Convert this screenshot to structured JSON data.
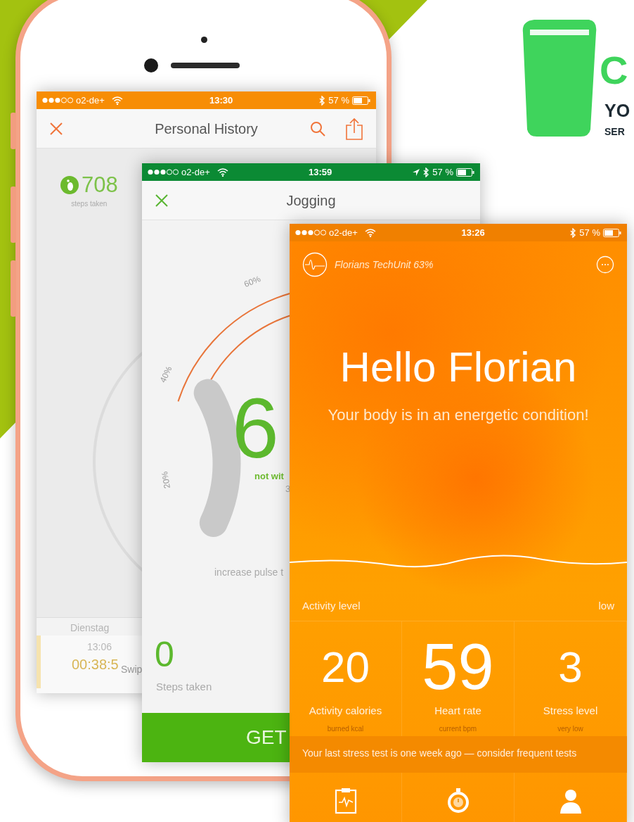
{
  "logo": {
    "letter": "C",
    "line_1": "YO",
    "line_2": "SER"
  },
  "history_screen": {
    "status": {
      "carrier": "o2-de+",
      "time": "13:30",
      "battery": "57 %",
      "location": false
    },
    "title": "Personal History",
    "steps": "708",
    "steps_label": "steps taken",
    "day": "Dienstag",
    "entry_time": "13:06",
    "entry_duration": "00:38:5",
    "hint": "Swip"
  },
  "jogging_screen": {
    "status": {
      "carrier": "o2-de+",
      "time": "13:59",
      "battery": "57 %",
      "location": true
    },
    "title": "Jogging",
    "gauge_ticks": [
      "60%",
      "40%",
      "20%"
    ],
    "pulse_digit": "6",
    "pulse_status": "not wit",
    "pulse_value": "3",
    "instruction": "increase pulse t",
    "steps": "0",
    "steps_label": "Steps taken",
    "start_button": "GET"
  },
  "home_screen": {
    "status": {
      "carrier": "o2-de+",
      "time": "13:26",
      "battery": "57 %",
      "location": false
    },
    "device": "Florians TechUnit 63%",
    "greeting": "Hello Florian",
    "subtitle": "Your body is in an energetic condition!",
    "activity_label": "Activity level",
    "activity_value": "low",
    "stats": [
      {
        "value": "20",
        "label": "Activity calories",
        "sub": "burned kcal",
        "highlighted": false
      },
      {
        "value": "59",
        "label": "Heart rate",
        "sub": "current bpm",
        "highlighted": true
      },
      {
        "value": "3",
        "label": "Stress level",
        "sub": "very low",
        "highlighted": false
      }
    ],
    "banner": "Your last stress test is one week ago — consider frequent tests",
    "nav": [
      {
        "kind": "report"
      },
      {
        "kind": "timer"
      },
      {
        "kind": "profile"
      }
    ]
  }
}
